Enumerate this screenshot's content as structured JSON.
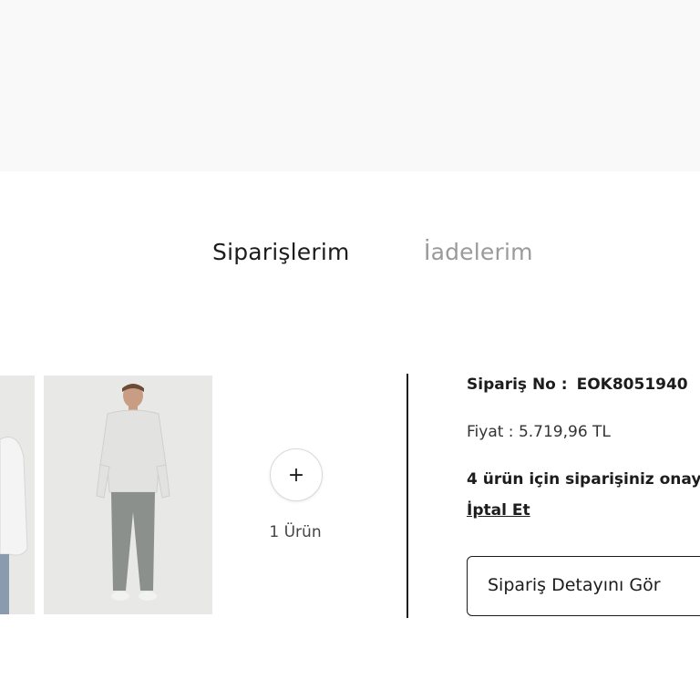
{
  "tabs": {
    "orders": "Siparişlerim",
    "returns": "İadelerim"
  },
  "order": {
    "more_button_symbol": "+",
    "more_count_label": "1 Ürün",
    "order_no_label": "Sipariş No :",
    "order_no_value": "EOK8051940",
    "price_label": "Fiyat : 5.719,96 TL",
    "status_text": "4 ürün için siparişiniz onay",
    "cancel_label": "İptal Et",
    "detail_button_label": "Sipariş Detayını Gör"
  },
  "colors": {
    "text": "#1c1c1c",
    "inactive_tab": "#9a9a9a",
    "header_band": "#f9f9f9",
    "image_bg": "#e8e8e6"
  }
}
